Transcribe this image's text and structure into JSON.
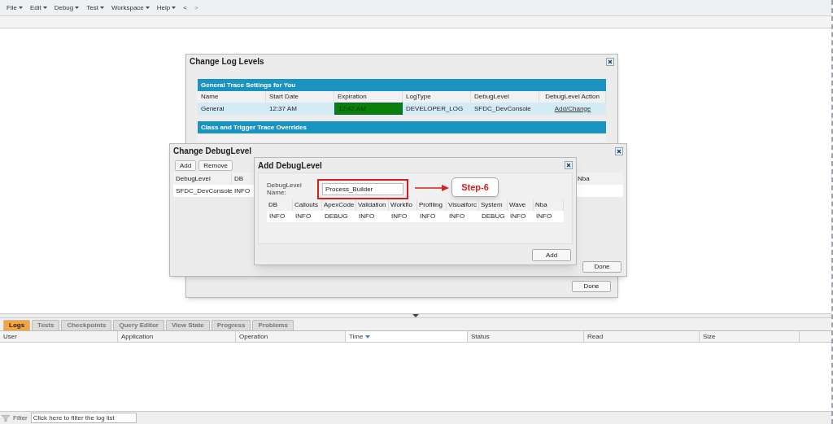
{
  "menu": [
    {
      "label": "File",
      "caret": true
    },
    {
      "label": "Edit",
      "caret": true
    },
    {
      "label": "Debug",
      "caret": true
    },
    {
      "label": "Test",
      "caret": true
    },
    {
      "label": "Workspace",
      "caret": true
    },
    {
      "label": "Help",
      "caret": true
    },
    {
      "label": "<",
      "caret": false,
      "disabled": false
    },
    {
      "label": ">",
      "caret": false,
      "disabled": true
    }
  ],
  "log_levels": {
    "title": "Change Log Levels",
    "general": {
      "title": "General Trace Settings for You",
      "columns": [
        "Name",
        "Start Date",
        "Expiration",
        "LogType",
        "DebugLevel",
        "DebugLevel Action"
      ],
      "rows": [
        {
          "cells": [
            {
              "text": "General",
              "kind": "text"
            },
            {
              "text": "12:37 AM",
              "kind": "text"
            },
            {
              "text": "12:42 AM",
              "kind": "highlight"
            },
            {
              "text": "DEVELOPER_LOG",
              "kind": "text"
            },
            {
              "text": "SFDC_DevConsole",
              "kind": "text"
            },
            {
              "text": "Add/Change",
              "kind": "link"
            }
          ]
        }
      ]
    },
    "overrides": {
      "title": "Class and Trigger Trace Overrides"
    },
    "done": "Done"
  },
  "change_debuglevel": {
    "title": "Change DebugLevel",
    "buttons": [
      "Add",
      "Remove"
    ],
    "columns": [
      "DebugLevel",
      "DB",
      "Nba"
    ],
    "rows": [
      [
        "SFDC_DevConsole",
        "INFO"
      ]
    ],
    "done": "Done"
  },
  "add_debuglevel": {
    "title": "Add DebugLevel",
    "name_label": "DebugLevel Name:",
    "name_value": "Process_Builder",
    "columns": [
      "DB",
      "Callouts",
      "ApexCode",
      "Validation",
      "Workflo",
      "Profiling",
      "Visualforc",
      "System",
      "Wave",
      "Nba"
    ],
    "rows": [
      [
        "INFO",
        "INFO",
        "DEBUG",
        "INFO",
        "INFO",
        "INFO",
        "INFO",
        "DEBUG",
        "INFO",
        "INFO"
      ]
    ],
    "add": "Add"
  },
  "callout": "Step-6",
  "tabs": [
    {
      "label": "Logs",
      "selected": true
    },
    {
      "label": "Tests",
      "selected": false
    },
    {
      "label": "Checkpoints",
      "selected": false
    },
    {
      "label": "Query Editor",
      "selected": false
    },
    {
      "label": "View State",
      "selected": false
    },
    {
      "label": "Progress",
      "selected": false
    },
    {
      "label": "Problems",
      "selected": false
    }
  ],
  "log_table": {
    "columns": [
      {
        "label": "User",
        "sorted": false
      },
      {
        "label": "Application",
        "sorted": false
      },
      {
        "label": "Operation",
        "sorted": false
      },
      {
        "label": "Time",
        "sorted": true
      },
      {
        "label": "Status",
        "sorted": false
      },
      {
        "label": "Read",
        "sorted": false
      },
      {
        "label": "Size",
        "sorted": false
      }
    ]
  },
  "filter": {
    "label": "Filter",
    "placeholder": "Click here to filter the log list"
  }
}
